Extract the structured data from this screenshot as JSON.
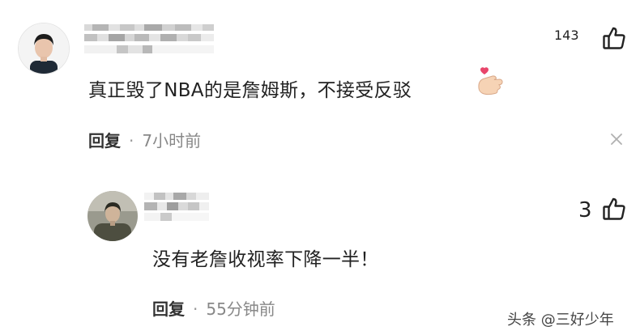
{
  "comments": [
    {
      "likes": "143",
      "text": "真正毁了NBA的是詹姆斯，不接受反驳",
      "reply_label": "回复",
      "time": "7小时前",
      "emoji": "finger-heart-emoji"
    },
    {
      "likes": "3",
      "text": "没有老詹收视率下降一半！",
      "reply_label": "回复",
      "time": "55分钟前"
    }
  ],
  "meta_separator": "·",
  "watermark": "头条 @三好少年",
  "icons": {
    "like": "thumbs-up-icon",
    "close": "close-icon"
  },
  "colors": {
    "text": "#222222",
    "meta": "#888888",
    "background": "#ffffff",
    "heart": "#e8456b"
  }
}
